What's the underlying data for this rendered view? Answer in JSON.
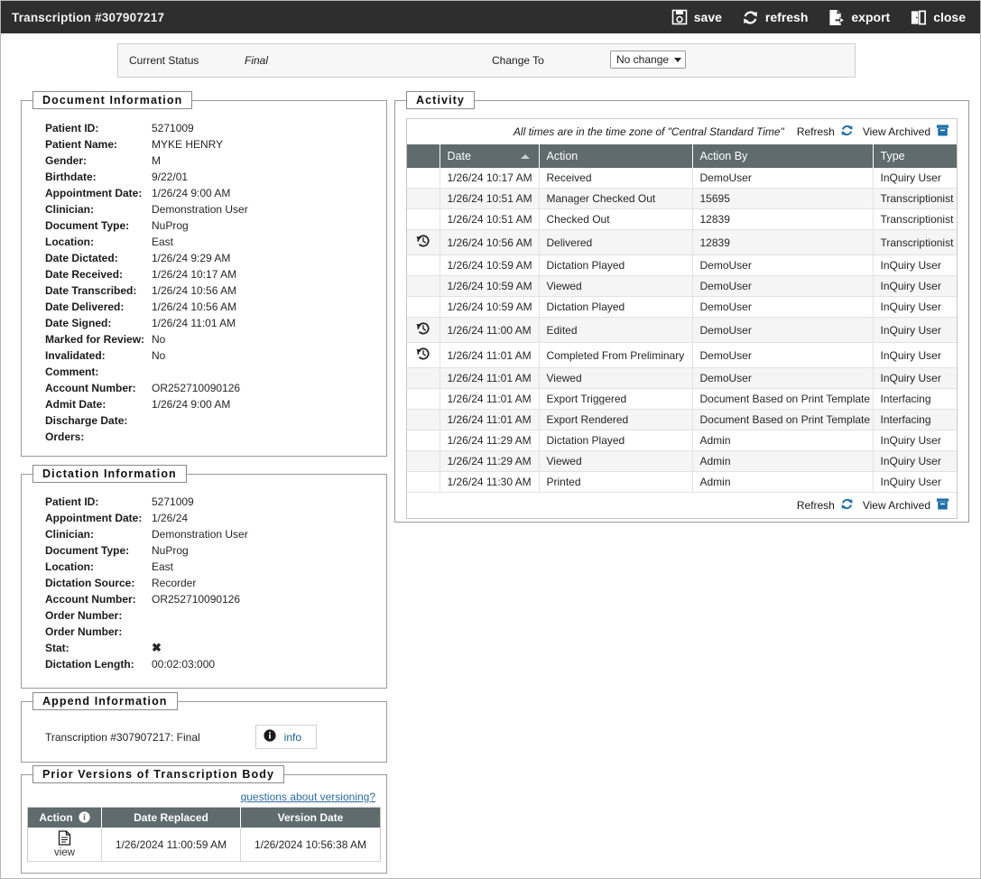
{
  "window": {
    "title": "Transcription #307907217"
  },
  "toolbar": {
    "items": [
      {
        "label": "save",
        "icon": "save-icon"
      },
      {
        "label": "refresh",
        "icon": "refresh-icon"
      },
      {
        "label": "export",
        "icon": "export-icon"
      },
      {
        "label": "close",
        "icon": "close-door-icon"
      }
    ]
  },
  "status_strip": {
    "current_status_label": "Current Status",
    "current_status_value": "Final",
    "change_to_label": "Change To",
    "change_to_value": "No change",
    "change_to_options": [
      "No change"
    ]
  },
  "document_information": {
    "legend": "Document Information",
    "rows": [
      {
        "key": "Patient ID:",
        "value": "5271009"
      },
      {
        "key": "Patient Name:",
        "value": "MYKE HENRY"
      },
      {
        "key": "Gender:",
        "value": "M"
      },
      {
        "key": "Birthdate:",
        "value": "9/22/01"
      },
      {
        "key": "Appointment Date:",
        "value": "1/26/24 9:00 AM"
      },
      {
        "key": "Clinician:",
        "value": "Demonstration User"
      },
      {
        "key": "Document Type:",
        "value": "NuProg"
      },
      {
        "key": "Location:",
        "value": "East"
      },
      {
        "key": "Date Dictated:",
        "value": "1/26/24 9:29 AM"
      },
      {
        "key": "Date Received:",
        "value": "1/26/24 10:17 AM"
      },
      {
        "key": "Date Transcribed:",
        "value": "1/26/24 10:56 AM"
      },
      {
        "key": "Date Delivered:",
        "value": "1/26/24 10:56 AM"
      },
      {
        "key": "Date Signed:",
        "value": "1/26/24 11:01 AM"
      },
      {
        "key": "Marked for Review:",
        "value": "No"
      },
      {
        "key": "Invalidated:",
        "value": "No"
      },
      {
        "key": "Comment:",
        "value": ""
      },
      {
        "key": "Account Number:",
        "value": "OR252710090126"
      },
      {
        "key": "Admit Date:",
        "value": "1/26/24 9:00 AM"
      },
      {
        "key": "Discharge Date:",
        "value": ""
      },
      {
        "key": "Orders:",
        "value": ""
      }
    ]
  },
  "dictation_information": {
    "legend": "Dictation Information",
    "rows": [
      {
        "key": "Patient ID:",
        "value": "5271009"
      },
      {
        "key": "Appointment Date:",
        "value": "1/26/24"
      },
      {
        "key": "Clinician:",
        "value": "Demonstration User"
      },
      {
        "key": "Document Type:",
        "value": "NuProg"
      },
      {
        "key": "Location:",
        "value": "East"
      },
      {
        "key": "Dictation Source:",
        "value": "Recorder"
      },
      {
        "key": "Account Number:",
        "value": "OR252710090126"
      },
      {
        "key": "Order Number:",
        "value": ""
      },
      {
        "key": "Order Number:",
        "value": ""
      },
      {
        "key": "Stat:",
        "value": "✖",
        "is_icon": true
      },
      {
        "key": "Dictation Length:",
        "value": "00:02:03:000"
      }
    ]
  },
  "append_information": {
    "legend": "Append Information",
    "text": "Transcription #307907217: Final",
    "info_button_label": "info"
  },
  "prior_versions": {
    "legend": "Prior Versions of Transcription Body",
    "help_link": "questions about versioning?",
    "columns": [
      "Action",
      "Date Replaced",
      "Version Date"
    ],
    "rows": [
      {
        "action_label": "view",
        "date_replaced": "1/26/2024 11:00:59 AM",
        "version_date": "1/26/2024 10:56:38 AM"
      }
    ]
  },
  "activity": {
    "legend": "Activity",
    "timezone_note": "All times are in the time zone of \"Central Standard Time\"",
    "refresh_label": "Refresh",
    "view_archived_label": "View Archived",
    "columns": [
      "",
      "Date",
      "Action",
      "Action By",
      "Type"
    ],
    "sort_column": "Date",
    "sort_direction": "asc",
    "rows": [
      {
        "history": false,
        "date": "1/26/24 10:17 AM",
        "action": "Received",
        "action_by": "DemoUser",
        "type": "InQuiry User"
      },
      {
        "history": false,
        "date": "1/26/24 10:51 AM",
        "action": "Manager Checked Out",
        "action_by": "15695",
        "type": "Transcriptionist"
      },
      {
        "history": false,
        "date": "1/26/24 10:51 AM",
        "action": "Checked Out",
        "action_by": "12839",
        "type": "Transcriptionist"
      },
      {
        "history": true,
        "date": "1/26/24 10:56 AM",
        "action": "Delivered",
        "action_by": "12839",
        "type": "Transcriptionist"
      },
      {
        "history": false,
        "date": "1/26/24 10:59 AM",
        "action": "Dictation Played",
        "action_by": "DemoUser",
        "type": "InQuiry User"
      },
      {
        "history": false,
        "date": "1/26/24 10:59 AM",
        "action": "Viewed",
        "action_by": "DemoUser",
        "type": "InQuiry User"
      },
      {
        "history": false,
        "date": "1/26/24 10:59 AM",
        "action": "Dictation Played",
        "action_by": "DemoUser",
        "type": "InQuiry User"
      },
      {
        "history": true,
        "date": "1/26/24 11:00 AM",
        "action": "Edited",
        "action_by": "DemoUser",
        "type": "InQuiry User"
      },
      {
        "history": true,
        "date": "1/26/24 11:01 AM",
        "action": "Completed From Preliminary",
        "action_by": "DemoUser",
        "type": "InQuiry User"
      },
      {
        "history": false,
        "date": "1/26/24 11:01 AM",
        "action": "Viewed",
        "action_by": "DemoUser",
        "type": "InQuiry User"
      },
      {
        "history": false,
        "date": "1/26/24 11:01 AM",
        "action": "Export Triggered",
        "action_by": "Document Based on Print Template",
        "type": "Interfacing"
      },
      {
        "history": false,
        "date": "1/26/24 11:01 AM",
        "action": "Export Rendered",
        "action_by": "Document Based on Print Template",
        "type": "Interfacing"
      },
      {
        "history": false,
        "date": "1/26/24 11:29 AM",
        "action": "Dictation Played",
        "action_by": "Admin",
        "type": "InQuiry User"
      },
      {
        "history": false,
        "date": "1/26/24 11:29 AM",
        "action": "Viewed",
        "action_by": "Admin",
        "type": "InQuiry User"
      },
      {
        "history": false,
        "date": "1/26/24 11:30 AM",
        "action": "Printed",
        "action_by": "Admin",
        "type": "InQuiry User"
      }
    ]
  },
  "colors": {
    "titlebar_bg": "#2e2e2e",
    "table_header_bg": "#5f6b6d",
    "link": "#2b6ca3",
    "icon_blue": "#1f6fa8",
    "stat_red": "#8c1414"
  }
}
